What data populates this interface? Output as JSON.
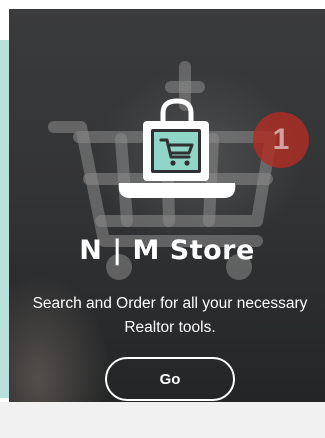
{
  "store_card": {
    "title": "N | M Store",
    "description": "Search and Order for all your necessary Realtor tools.",
    "button_label": "Go",
    "badge_count": "1",
    "icon": "shopping-bag-laptop-icon",
    "background_icon": "shopping-cart-icon"
  },
  "colors": {
    "card_background": "#2f3032",
    "text": "#ffffff",
    "bag_accent": "#8fd6c8",
    "badge": "#b02d23",
    "side_panel": "#b9e1db"
  }
}
